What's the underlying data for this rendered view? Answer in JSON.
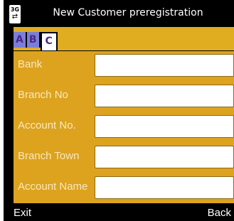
{
  "header": {
    "title": "New Customer preregistration",
    "network_badge": "3G",
    "network_arrows": "⇄"
  },
  "tabs": [
    {
      "label": "A",
      "active": false
    },
    {
      "label": "B",
      "active": false
    },
    {
      "label": "C",
      "active": true
    }
  ],
  "form": {
    "fields": [
      {
        "label": "Bank",
        "value": ""
      },
      {
        "label": "Branch No",
        "value": ""
      },
      {
        "label": "Account No.",
        "value": ""
      },
      {
        "label": "Branch Town",
        "value": ""
      },
      {
        "label": "Account Name",
        "value": ""
      }
    ]
  },
  "softkeys": {
    "left": "Exit",
    "right": "Back"
  },
  "colors": {
    "background": "#dda31f",
    "titlebar": "#000000",
    "tab_inactive": "#7a7fd8",
    "tab_text": "#4b2a86",
    "label_text": "#f7e9bf"
  }
}
